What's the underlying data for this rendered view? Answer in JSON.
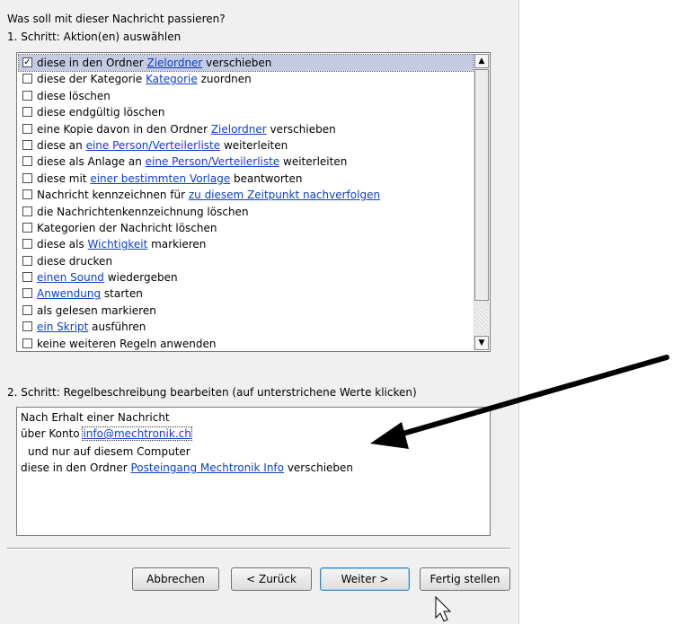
{
  "question": "Was soll mit dieser Nachricht passieren?",
  "step1": {
    "label": "1. Schritt: Aktion(en) auswählen",
    "actions": [
      {
        "checked": true,
        "parts": [
          {
            "t": "diese in den Ordner "
          },
          {
            "t": "Zielordner",
            "link": true
          },
          {
            "t": " verschieben"
          }
        ]
      },
      {
        "checked": false,
        "parts": [
          {
            "t": "diese der Kategorie "
          },
          {
            "t": "Kategorie",
            "link": true
          },
          {
            "t": " zuordnen"
          }
        ]
      },
      {
        "checked": false,
        "parts": [
          {
            "t": "diese löschen"
          }
        ]
      },
      {
        "checked": false,
        "parts": [
          {
            "t": "diese endgültig löschen"
          }
        ]
      },
      {
        "checked": false,
        "parts": [
          {
            "t": "eine Kopie davon in den Ordner "
          },
          {
            "t": "Zielordner",
            "link": true
          },
          {
            "t": " verschieben"
          }
        ]
      },
      {
        "checked": false,
        "parts": [
          {
            "t": "diese an "
          },
          {
            "t": "eine Person/Verteilerliste",
            "link": true
          },
          {
            "t": " weiterleiten"
          }
        ]
      },
      {
        "checked": false,
        "parts": [
          {
            "t": "diese als Anlage an "
          },
          {
            "t": "eine Person/Verteilerliste",
            "link": true
          },
          {
            "t": " weiterleiten"
          }
        ]
      },
      {
        "checked": false,
        "parts": [
          {
            "t": "diese mit "
          },
          {
            "t": "einer bestimmten Vorlage",
            "link": true
          },
          {
            "t": " beantworten"
          }
        ]
      },
      {
        "checked": false,
        "parts": [
          {
            "t": "Nachricht kennzeichnen für "
          },
          {
            "t": "zu diesem Zeitpunkt nachverfolgen",
            "link": true
          }
        ]
      },
      {
        "checked": false,
        "parts": [
          {
            "t": "die Nachrichtenkennzeichnung löschen"
          }
        ]
      },
      {
        "checked": false,
        "parts": [
          {
            "t": "Kategorien der Nachricht löschen"
          }
        ]
      },
      {
        "checked": false,
        "parts": [
          {
            "t": "diese als "
          },
          {
            "t": "Wichtigkeit",
            "link": true
          },
          {
            "t": " markieren"
          }
        ]
      },
      {
        "checked": false,
        "parts": [
          {
            "t": "diese drucken"
          }
        ]
      },
      {
        "checked": false,
        "parts": [
          {
            "t": "einen Sound",
            "link": true
          },
          {
            "t": " wiedergeben"
          }
        ]
      },
      {
        "checked": false,
        "parts": [
          {
            "t": "Anwendung",
            "link": true
          },
          {
            "t": " starten"
          }
        ]
      },
      {
        "checked": false,
        "parts": [
          {
            "t": "als gelesen markieren"
          }
        ]
      },
      {
        "checked": false,
        "parts": [
          {
            "t": "ein Skript",
            "link": true
          },
          {
            "t": " ausführen"
          }
        ]
      },
      {
        "checked": false,
        "parts": [
          {
            "t": "keine weiteren Regeln anwenden"
          }
        ]
      }
    ]
  },
  "step2": {
    "label": "2. Schritt: Regelbeschreibung bearbeiten (auf unterstrichene Werte klicken)",
    "line1": "Nach Erhalt einer Nachricht",
    "line2_prefix": "über Konto ",
    "account_link": "info@mechtronik.ch",
    "line3": "und nur auf diesem Computer",
    "line4_prefix": "diese in den Ordner ",
    "folder_link": "Posteingang Mechtronik Info",
    "line4_suffix": " verschieben"
  },
  "buttons": {
    "cancel": "Abbrechen",
    "back": "< Zurück",
    "next": "Weiter >",
    "finish": "Fertig stellen"
  },
  "colors": {
    "dialog_bg": "#f0f0f0",
    "link": "#0b3fc8",
    "selection": "#c5cbe3",
    "arrow": "#000000"
  }
}
